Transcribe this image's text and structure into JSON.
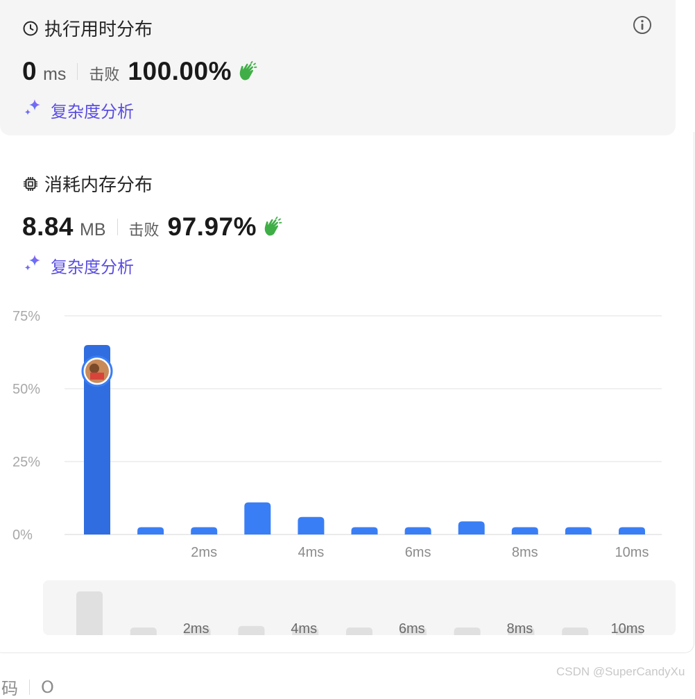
{
  "runtime": {
    "title": "执行用时分布",
    "value": "0",
    "unit": "ms",
    "beat_label": "击败",
    "beat_percent": "100.00%",
    "complexity_link": "复杂度分析"
  },
  "memory": {
    "title": "消耗内存分布",
    "value": "8.84",
    "unit": "MB",
    "beat_label": "击败",
    "beat_percent": "97.97%",
    "complexity_link": "复杂度分析"
  },
  "colors": {
    "bar": "#3a7ef5",
    "bar_highlight": "#2f6de0",
    "mini_bar": "#e0e0e0",
    "clap": "#3fae46",
    "link_gradient_start": "#3b82f6",
    "link_gradient_end": "#a855f7"
  },
  "chart_data": {
    "type": "bar",
    "categories": [
      "0ms",
      "1ms",
      "2ms",
      "3ms",
      "4ms",
      "5ms",
      "6ms",
      "7ms",
      "8ms",
      "9ms",
      "10ms"
    ],
    "values": [
      65,
      2.5,
      2.5,
      11,
      6,
      2.5,
      2.5,
      4.5,
      2.5,
      2.5,
      2.5
    ],
    "x_tick_labels": [
      "2ms",
      "4ms",
      "6ms",
      "8ms",
      "10ms"
    ],
    "y_tick_labels": [
      "75%",
      "50%",
      "25%",
      "0%"
    ],
    "y_ticks": [
      75,
      50,
      25,
      0
    ],
    "ylim": [
      0,
      75
    ],
    "highlight_index": 0,
    "highlight_marker_value": 56,
    "grid": true
  },
  "watermark": "CSDN @SuperCandyXu",
  "cutoff_text": [
    "码",
    "O"
  ]
}
